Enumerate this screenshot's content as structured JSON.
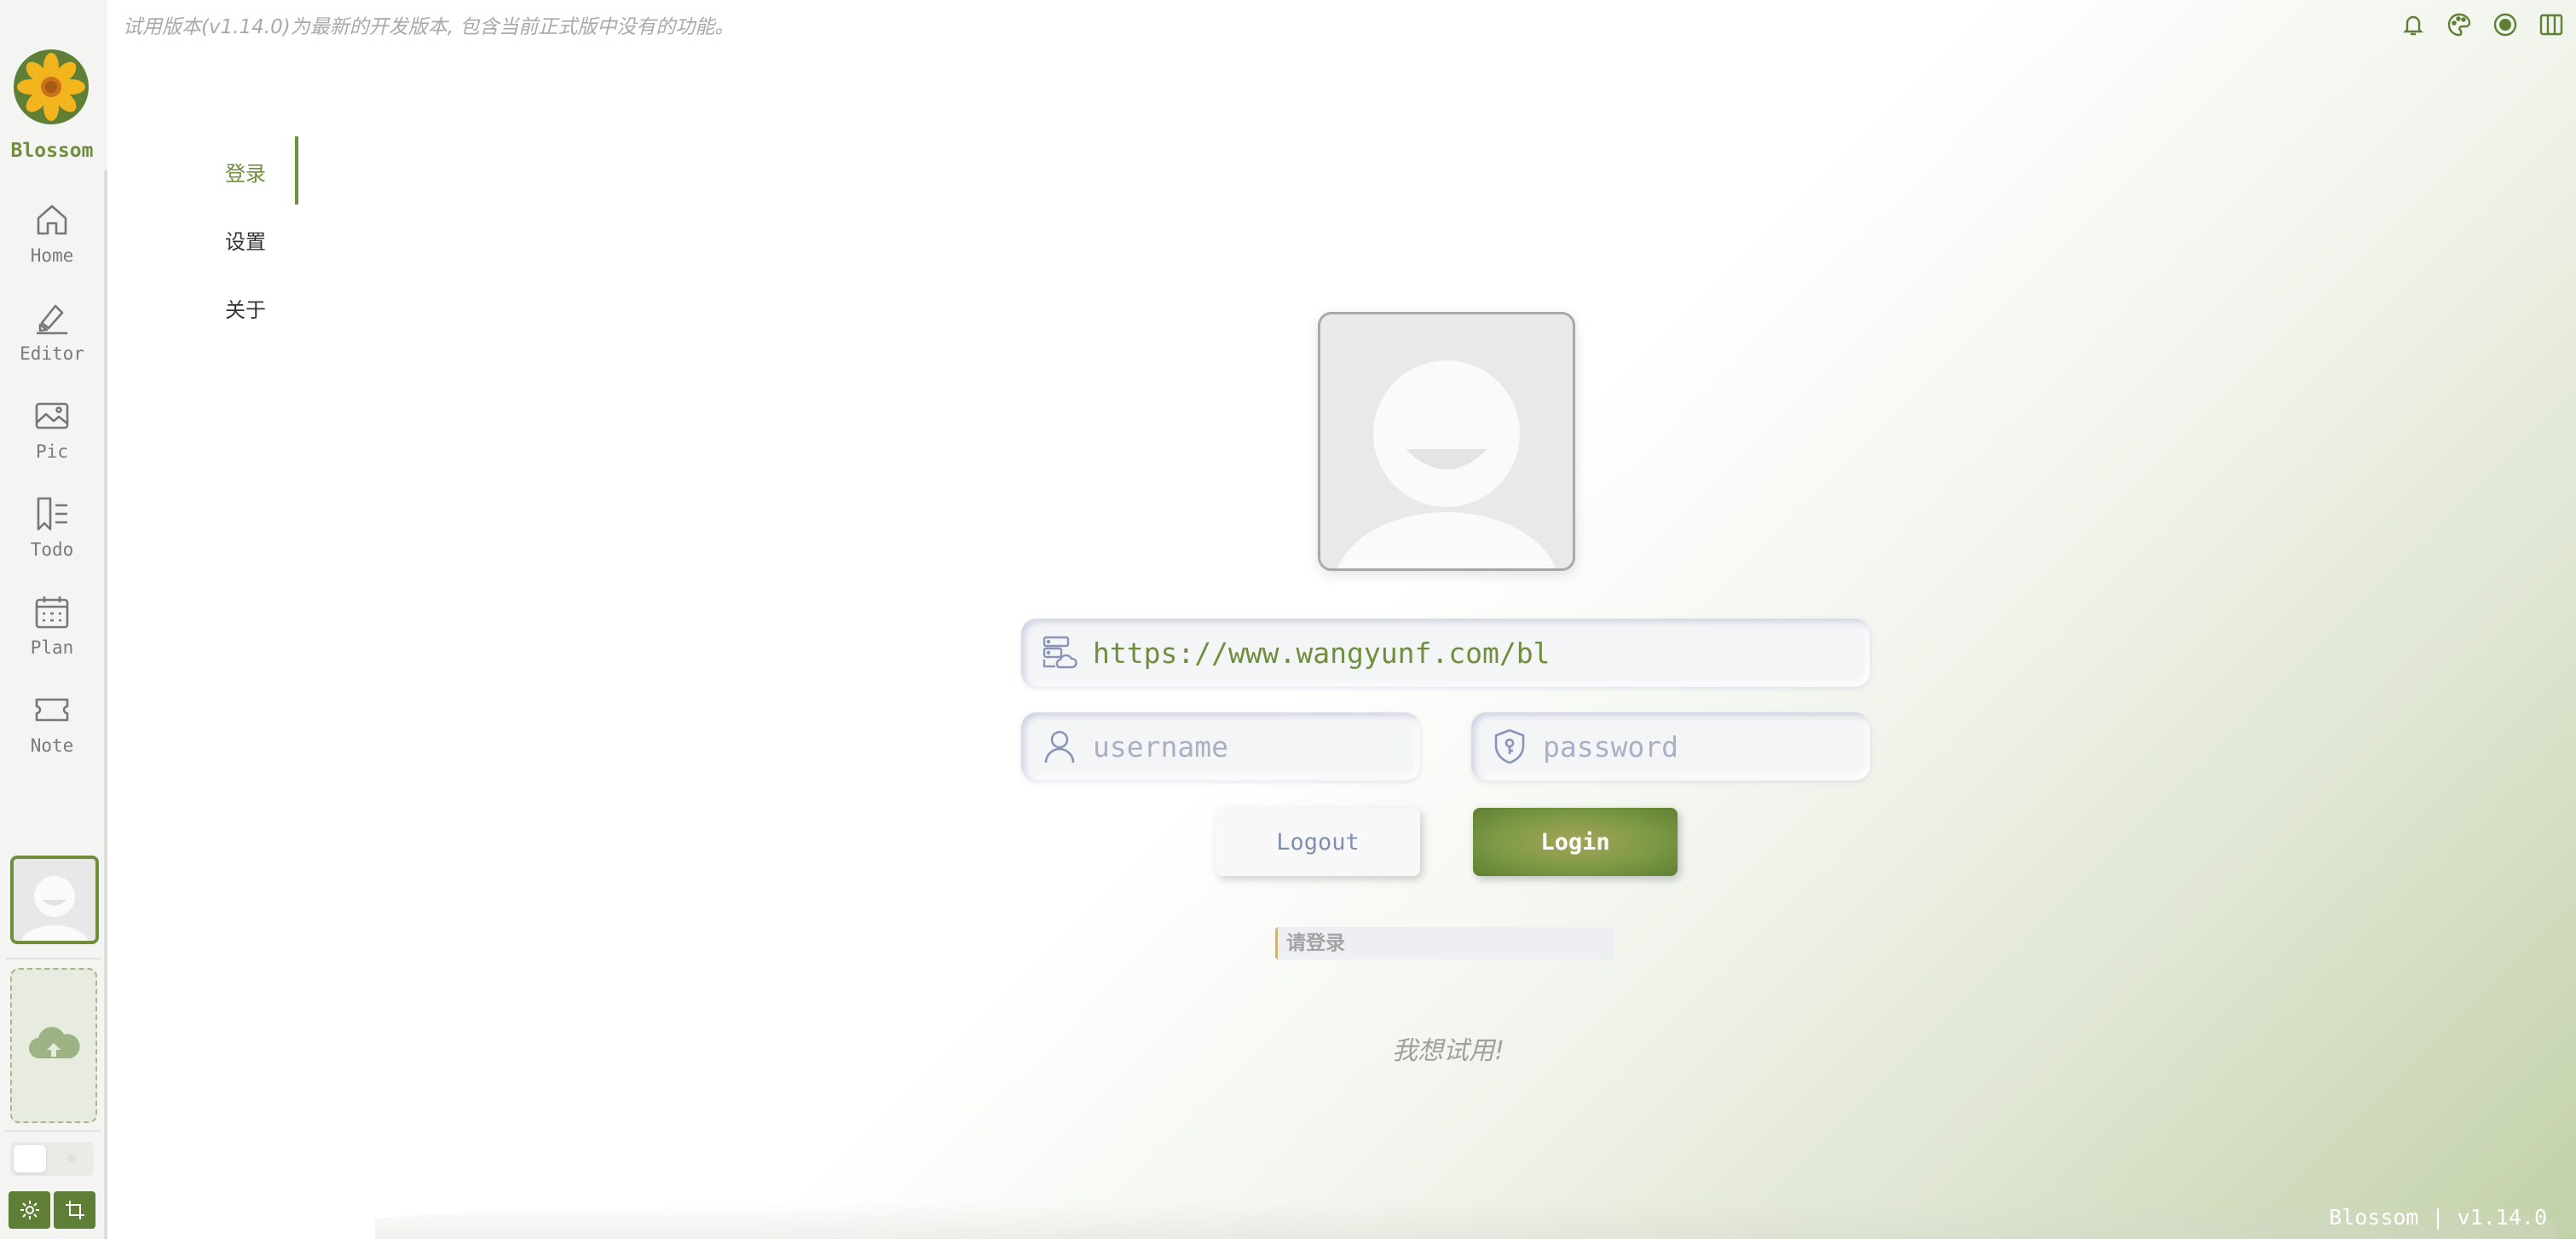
{
  "app": {
    "name": "Blossom",
    "version_footer": "Blossom | v1.14.0"
  },
  "notice": "试用版本(v1.14.0)为最新的开发版本, 包含当前正式版中没有的功能。",
  "top_icons": [
    "bell-icon",
    "palette-icon",
    "record-icon",
    "columns-icon"
  ],
  "sidebar": {
    "items": [
      {
        "label": "Home",
        "icon": "home-icon"
      },
      {
        "label": "Editor",
        "icon": "editor-icon"
      },
      {
        "label": "Pic",
        "icon": "picture-icon"
      },
      {
        "label": "Todo",
        "icon": "todo-icon"
      },
      {
        "label": "Plan",
        "icon": "calendar-icon"
      },
      {
        "label": "Note",
        "icon": "ticket-icon"
      }
    ]
  },
  "tabs": [
    {
      "label": "登录",
      "active": true
    },
    {
      "label": "设置",
      "active": false
    },
    {
      "label": "关于",
      "active": false
    }
  ],
  "login": {
    "server_url": "https://www.wangyunf.com/bl",
    "username_placeholder": "username",
    "password_placeholder": "password",
    "logout_label": "Logout",
    "login_label": "Login",
    "status_text": "请登录",
    "trial_text": "我想试用!"
  },
  "colors": {
    "accent": "#6f8f3d",
    "placeholder": "#a9b0c6",
    "logout_text": "#7f8fb3"
  }
}
